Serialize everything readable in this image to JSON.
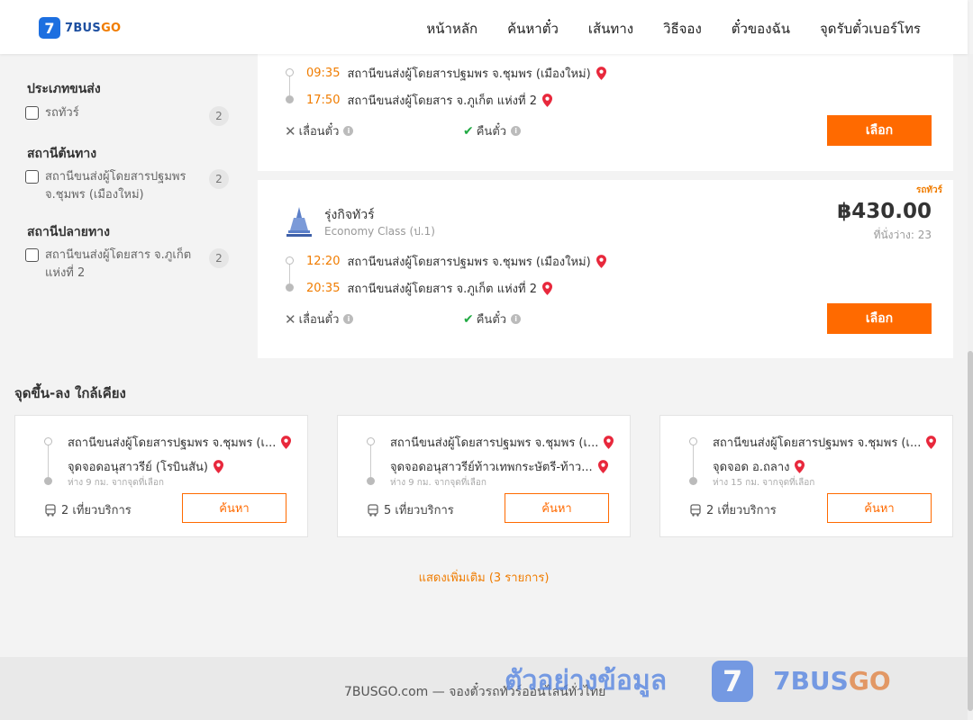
{
  "header": {
    "logo_text_main": "7BUS",
    "logo_text_accent": "GO",
    "logo_mark": "7",
    "nav": [
      "หน้าหลัก",
      "ค้นหาตั๋ว",
      "เส้นทาง",
      "วิธีจอง",
      "ตั๋วของฉัน",
      "จุดรับตั๋วเบอร์โทร"
    ]
  },
  "filters": {
    "bus_type": {
      "title": "ประเภทขนส่ง",
      "items": [
        {
          "label": "รถทัวร์",
          "count": "2"
        }
      ]
    },
    "origin": {
      "title": "สถานีต้นทาง",
      "items": [
        {
          "label": "สถานีขนส่งผู้โดยสารปฐมพร จ.ชุมพร (เมืองใหม่)",
          "count": "2"
        }
      ]
    },
    "destination": {
      "title": "สถานีปลายทาง",
      "items": [
        {
          "label": "สถานีขนส่งผู้โดยสาร จ.ภูเก็ต แห่งที่ 2",
          "count": "2"
        }
      ]
    }
  },
  "trips": [
    {
      "depart_time": "09:35",
      "depart_station": "สถานีขนส่งผู้โดยสารปฐมพร จ.ชุมพร (เมืองใหม่)",
      "arrive_time": "17:50",
      "arrive_station": "สถานีขนส่งผู้โดยสาร จ.ภูเก็ต แห่งที่ 2",
      "reschedule": "เลื่อนตั๋ว",
      "refund": "คืนตั๋ว",
      "select": "เลือก"
    },
    {
      "bus_type": "รถทัวร์",
      "operator": "รุ่งกิจทัวร์",
      "class": "Economy Class (ป.1)",
      "price": "฿430.00",
      "seats": "ที่นั่งว่าง: 23",
      "depart_time": "12:20",
      "depart_station": "สถานีขนส่งผู้โดยสารปฐมพร จ.ชุมพร (เมืองใหม่)",
      "arrive_time": "20:35",
      "arrive_station": "สถานีขนส่งผู้โดยสาร จ.ภูเก็ต แห่งที่ 2",
      "reschedule": "เลื่อนตั๋ว",
      "refund": "คืนตั๋ว",
      "select": "เลือก"
    }
  ],
  "nearby": {
    "title": "จุดขึ้น-ลง ใกล้เคียง",
    "cards": [
      {
        "from": "สถานีขนส่งผู้โดยสารปฐมพร จ.ชุมพร (เ...",
        "to": "จุดจอดอนุสาวรีย์ (โรบินสัน)",
        "distance": "ห่าง 9 กม. จากจุดที่เลือก",
        "trips": "2 เที่ยวบริการ",
        "button": "ค้นหา"
      },
      {
        "from": "สถานีขนส่งผู้โดยสารปฐมพร จ.ชุมพร (เ...",
        "to": "จุดจอดอนุสาวรีย์ท้าวเทพกระษัตรี-ท้าว...",
        "distance": "ห่าง 9 กม. จากจุดที่เลือก",
        "trips": "5 เที่ยวบริการ",
        "button": "ค้นหา"
      },
      {
        "from": "สถานีขนส่งผู้โดยสารปฐมพร จ.ชุมพร (เ...",
        "to": "จุดจอด อ.ถลาง",
        "distance": "ห่าง 15 กม. จากจุดที่เลือก",
        "trips": "2 เที่ยวบริการ",
        "button": "ค้นหา"
      }
    ],
    "show_more": "แสดงเพิ่มเติม (3 รายการ)"
  },
  "footer": {
    "text": "7BUSGO.com — จองตั๋วรถทัวร์ออนไลน์ทั่วไทย"
  },
  "watermark": {
    "thai": "ตัวอย่างข้อมูล",
    "mark": "7",
    "brand_main": "7BUS",
    "brand_accent": "GO"
  },
  "colors": {
    "accent": "#ff6a00",
    "brand_blue": "#1d6fe0",
    "time": "#f07c00",
    "check": "#22aa44",
    "pin": "#e8283c"
  }
}
